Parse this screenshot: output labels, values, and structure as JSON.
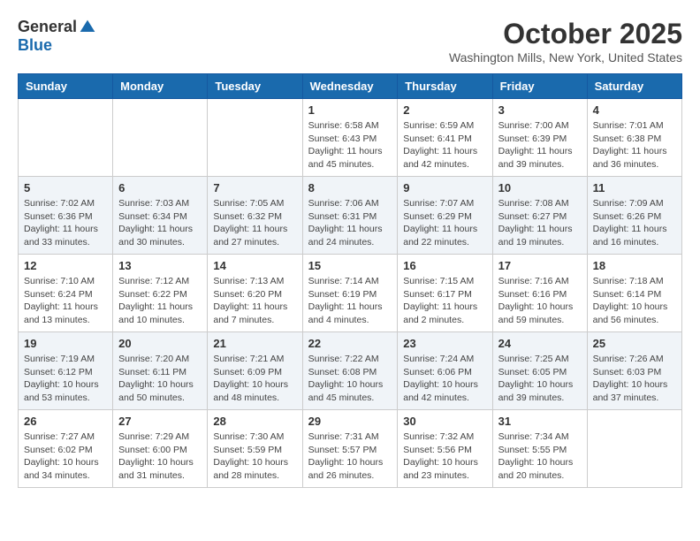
{
  "logo": {
    "general": "General",
    "blue": "Blue"
  },
  "title": "October 2025",
  "subtitle": "Washington Mills, New York, United States",
  "days_of_week": [
    "Sunday",
    "Monday",
    "Tuesday",
    "Wednesday",
    "Thursday",
    "Friday",
    "Saturday"
  ],
  "weeks": [
    [
      {
        "day": "",
        "info": ""
      },
      {
        "day": "",
        "info": ""
      },
      {
        "day": "",
        "info": ""
      },
      {
        "day": "1",
        "info": "Sunrise: 6:58 AM\nSunset: 6:43 PM\nDaylight: 11 hours and 45 minutes."
      },
      {
        "day": "2",
        "info": "Sunrise: 6:59 AM\nSunset: 6:41 PM\nDaylight: 11 hours and 42 minutes."
      },
      {
        "day": "3",
        "info": "Sunrise: 7:00 AM\nSunset: 6:39 PM\nDaylight: 11 hours and 39 minutes."
      },
      {
        "day": "4",
        "info": "Sunrise: 7:01 AM\nSunset: 6:38 PM\nDaylight: 11 hours and 36 minutes."
      }
    ],
    [
      {
        "day": "5",
        "info": "Sunrise: 7:02 AM\nSunset: 6:36 PM\nDaylight: 11 hours and 33 minutes."
      },
      {
        "day": "6",
        "info": "Sunrise: 7:03 AM\nSunset: 6:34 PM\nDaylight: 11 hours and 30 minutes."
      },
      {
        "day": "7",
        "info": "Sunrise: 7:05 AM\nSunset: 6:32 PM\nDaylight: 11 hours and 27 minutes."
      },
      {
        "day": "8",
        "info": "Sunrise: 7:06 AM\nSunset: 6:31 PM\nDaylight: 11 hours and 24 minutes."
      },
      {
        "day": "9",
        "info": "Sunrise: 7:07 AM\nSunset: 6:29 PM\nDaylight: 11 hours and 22 minutes."
      },
      {
        "day": "10",
        "info": "Sunrise: 7:08 AM\nSunset: 6:27 PM\nDaylight: 11 hours and 19 minutes."
      },
      {
        "day": "11",
        "info": "Sunrise: 7:09 AM\nSunset: 6:26 PM\nDaylight: 11 hours and 16 minutes."
      }
    ],
    [
      {
        "day": "12",
        "info": "Sunrise: 7:10 AM\nSunset: 6:24 PM\nDaylight: 11 hours and 13 minutes."
      },
      {
        "day": "13",
        "info": "Sunrise: 7:12 AM\nSunset: 6:22 PM\nDaylight: 11 hours and 10 minutes."
      },
      {
        "day": "14",
        "info": "Sunrise: 7:13 AM\nSunset: 6:20 PM\nDaylight: 11 hours and 7 minutes."
      },
      {
        "day": "15",
        "info": "Sunrise: 7:14 AM\nSunset: 6:19 PM\nDaylight: 11 hours and 4 minutes."
      },
      {
        "day": "16",
        "info": "Sunrise: 7:15 AM\nSunset: 6:17 PM\nDaylight: 11 hours and 2 minutes."
      },
      {
        "day": "17",
        "info": "Sunrise: 7:16 AM\nSunset: 6:16 PM\nDaylight: 10 hours and 59 minutes."
      },
      {
        "day": "18",
        "info": "Sunrise: 7:18 AM\nSunset: 6:14 PM\nDaylight: 10 hours and 56 minutes."
      }
    ],
    [
      {
        "day": "19",
        "info": "Sunrise: 7:19 AM\nSunset: 6:12 PM\nDaylight: 10 hours and 53 minutes."
      },
      {
        "day": "20",
        "info": "Sunrise: 7:20 AM\nSunset: 6:11 PM\nDaylight: 10 hours and 50 minutes."
      },
      {
        "day": "21",
        "info": "Sunrise: 7:21 AM\nSunset: 6:09 PM\nDaylight: 10 hours and 48 minutes."
      },
      {
        "day": "22",
        "info": "Sunrise: 7:22 AM\nSunset: 6:08 PM\nDaylight: 10 hours and 45 minutes."
      },
      {
        "day": "23",
        "info": "Sunrise: 7:24 AM\nSunset: 6:06 PM\nDaylight: 10 hours and 42 minutes."
      },
      {
        "day": "24",
        "info": "Sunrise: 7:25 AM\nSunset: 6:05 PM\nDaylight: 10 hours and 39 minutes."
      },
      {
        "day": "25",
        "info": "Sunrise: 7:26 AM\nSunset: 6:03 PM\nDaylight: 10 hours and 37 minutes."
      }
    ],
    [
      {
        "day": "26",
        "info": "Sunrise: 7:27 AM\nSunset: 6:02 PM\nDaylight: 10 hours and 34 minutes."
      },
      {
        "day": "27",
        "info": "Sunrise: 7:29 AM\nSunset: 6:00 PM\nDaylight: 10 hours and 31 minutes."
      },
      {
        "day": "28",
        "info": "Sunrise: 7:30 AM\nSunset: 5:59 PM\nDaylight: 10 hours and 28 minutes."
      },
      {
        "day": "29",
        "info": "Sunrise: 7:31 AM\nSunset: 5:57 PM\nDaylight: 10 hours and 26 minutes."
      },
      {
        "day": "30",
        "info": "Sunrise: 7:32 AM\nSunset: 5:56 PM\nDaylight: 10 hours and 23 minutes."
      },
      {
        "day": "31",
        "info": "Sunrise: 7:34 AM\nSunset: 5:55 PM\nDaylight: 10 hours and 20 minutes."
      },
      {
        "day": "",
        "info": ""
      }
    ]
  ]
}
